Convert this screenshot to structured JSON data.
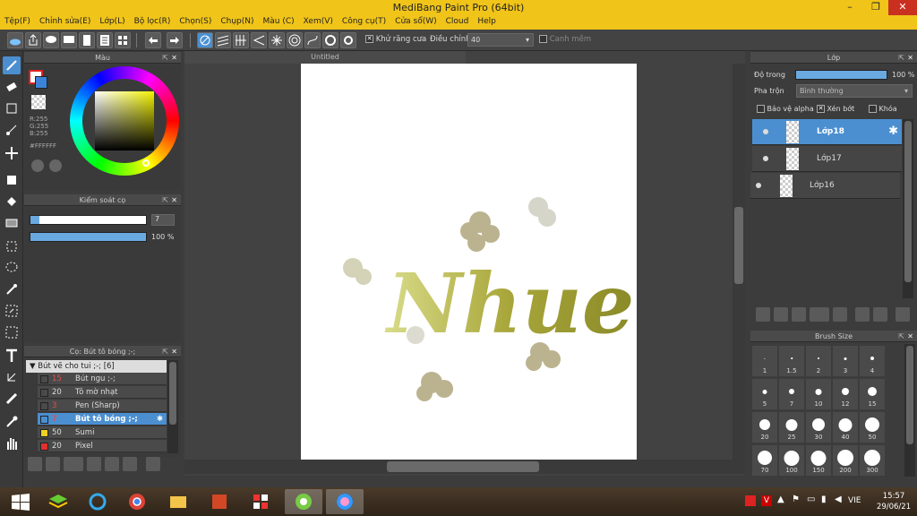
{
  "title": "MediBang Paint Pro (64bit)",
  "menu": [
    "Tệp(F)",
    "Chỉnh sửa(E)",
    "Lớp(L)",
    "Bộ lọc(R)",
    "Chọn(S)",
    "Chụp(N)",
    "Màu (C)",
    "Xem(V)",
    "Công cụ(T)",
    "Cửa sổ(W)",
    "Cloud",
    "Help"
  ],
  "toolbar": {
    "antialias_label": "Khử răng cưa",
    "correction_label": "Điều chỉnh",
    "correction_value": "40",
    "smooth_label": "Canh mềm"
  },
  "color_panel": {
    "title": "Màu",
    "r": "R:255",
    "g": "G:255",
    "b": "B:255",
    "hex": "#FFFFFF"
  },
  "brush_control": {
    "title": "Kiểm soát cọ",
    "size_value": "7",
    "opacity_value": "100 %",
    "size_fraction": 0.08,
    "opacity_fraction": 1.0
  },
  "brush_panel": {
    "title": "Cọ: Bút tô bóng ;-;",
    "group": "Bút vẽ cho tui ;-; [6]",
    "items": [
      {
        "size": "15",
        "name": "Bút ngu ;-;",
        "color": "#333333"
      },
      {
        "size": "20",
        "name": "Tô mờ nhạt",
        "color": "#333333"
      },
      {
        "size": "3",
        "name": "Pen (Sharp)",
        "color": "#333333"
      },
      {
        "size": "7",
        "name": "Bút tô bóng ;-;",
        "color": "#333333",
        "selected": true
      },
      {
        "size": "50",
        "name": "Sumi",
        "color": "#f0d020"
      },
      {
        "size": "20",
        "name": "Pixel",
        "color": "#e03030"
      }
    ]
  },
  "canvas": {
    "tab_title": "Untitled",
    "artwork_text": "Nhue"
  },
  "layer_panel": {
    "title": "Lớp",
    "opacity_label": "Độ trong",
    "opacity_value": "100 %",
    "blend_label": "Pha trộn",
    "blend_value": "Bình thường",
    "protect_alpha": "Bảo vệ alpha",
    "clipping": "Xén bớt",
    "lock": "Khóa",
    "layers": [
      {
        "name": "Lớp18",
        "selected": true
      },
      {
        "name": "Lớp17"
      },
      {
        "name": "Lớp16"
      }
    ]
  },
  "brush_size_panel": {
    "title": "Brush Size",
    "sizes": [
      "1",
      "1.5",
      "2",
      "3",
      "4",
      "5",
      "7",
      "10",
      "12",
      "15",
      "20",
      "25",
      "30",
      "40",
      "50",
      "70",
      "100",
      "150",
      "200",
      "300"
    ]
  },
  "taskbar": {
    "lang": "VIE",
    "time": "15:57",
    "date": "29/06/21"
  }
}
